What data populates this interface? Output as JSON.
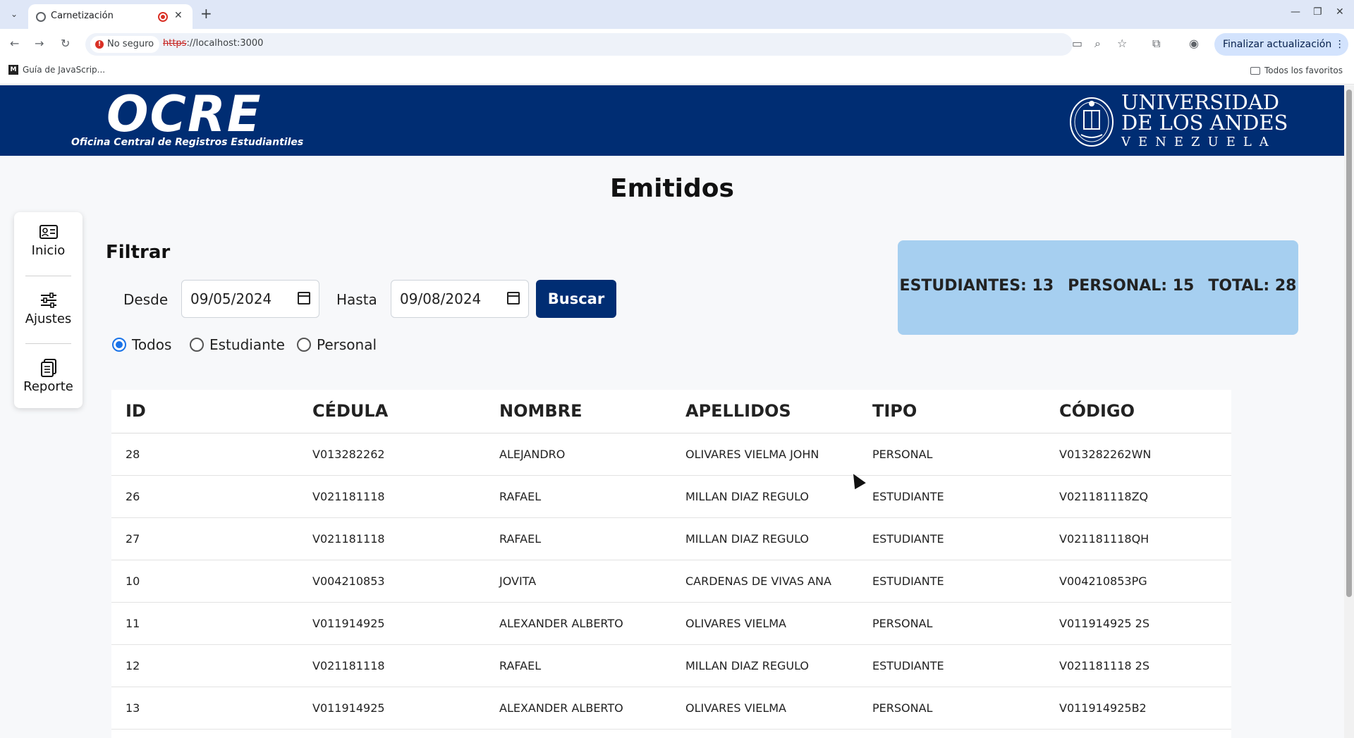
{
  "browser": {
    "tab_title": "Carnetización",
    "security_label": "No seguro",
    "url_scheme": "https",
    "url_rest": "://localhost:3000",
    "update_button": "Finalizar actualización",
    "bookmark_item": "Guía de JavaScrip...",
    "bookmark_icon_letter": "M",
    "all_bookmarks": "Todos los favoritos"
  },
  "header": {
    "logo": "OCRE",
    "logo_subtitle": "Oficina Central de Registros Estudiantiles",
    "university_line1": "UNIVERSIDAD",
    "university_line2": "DE LOS ANDES",
    "university_line3": "VENEZUELA"
  },
  "page": {
    "title": "Emitidos"
  },
  "sidebar": {
    "items": [
      {
        "label": "Inicio",
        "icon": "id-card-icon"
      },
      {
        "label": "Ajustes",
        "icon": "sliders-icon"
      },
      {
        "label": "Reporte",
        "icon": "clipboard-icon"
      }
    ]
  },
  "filter": {
    "title": "Filtrar",
    "from_label": "Desde",
    "from_value": "09/05/2024",
    "to_label": "Hasta",
    "to_value": "09/08/2024",
    "search_button": "Buscar",
    "radios": [
      {
        "label": "Todos",
        "checked": true
      },
      {
        "label": "Estudiante",
        "checked": false
      },
      {
        "label": "Personal",
        "checked": false
      }
    ]
  },
  "stats": {
    "students": "ESTUDIANTES: 13",
    "staff": "PERSONAL: 15",
    "total": "TOTAL: 28",
    "background_color": "#a6cff0"
  },
  "colors": {
    "brand": "#002d73"
  },
  "table": {
    "headers": [
      "ID",
      "CÉDULA",
      "NOMBRE",
      "APELLIDOS",
      "TIPO",
      "CÓDIGO"
    ],
    "rows": [
      [
        "28",
        "V013282262",
        "ALEJANDRO",
        "OLIVARES VIELMA JOHN",
        "PERSONAL",
        "V013282262WN"
      ],
      [
        "26",
        "V021181118",
        "RAFAEL",
        "MILLAN DIAZ REGULO",
        "ESTUDIANTE",
        "V021181118ZQ"
      ],
      [
        "27",
        "V021181118",
        "RAFAEL",
        "MILLAN DIAZ REGULO",
        "ESTUDIANTE",
        "V021181118QH"
      ],
      [
        "10",
        "V004210853",
        "JOVITA",
        "CARDENAS DE VIVAS ANA",
        "ESTUDIANTE",
        "V004210853PG"
      ],
      [
        "11",
        "V011914925",
        "ALEXANDER ALBERTO",
        "OLIVARES VIELMA",
        "PERSONAL",
        "V011914925 2S"
      ],
      [
        "12",
        "V021181118",
        "RAFAEL",
        "MILLAN DIAZ REGULO",
        "ESTUDIANTE",
        "V021181118 2S"
      ],
      [
        "13",
        "V011914925",
        "ALEXANDER ALBERTO",
        "OLIVARES VIELMA",
        "PERSONAL",
        "V011914925B2"
      ]
    ]
  }
}
